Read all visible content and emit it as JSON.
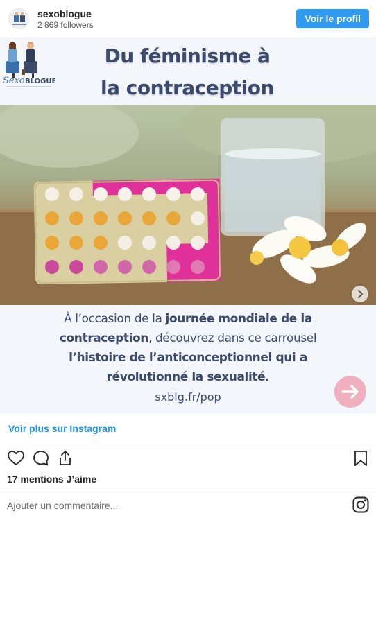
{
  "header": {
    "username": "sexoblogue",
    "followers": "2 869 followers",
    "view_profile_label": "Voir le profil"
  },
  "post": {
    "title_line1": "Du féminisme à",
    "title_line2": "la contraception",
    "brand_logo_text": "SexoBLOGUE",
    "body_line1_prefix": "À l’occasion de la ",
    "body_line1_bold": "journée mondiale de la",
    "body_line2_bold": "contraception",
    "body_line2_rest": ", découvrez dans ce carrousel",
    "body_line3_bold": "l’histoire de l’anticonceptionnel qui a",
    "body_line4_bold": "révolutionné la sexualité.",
    "url": "sxblg.fr/pop"
  },
  "footer": {
    "more_link": "Voir plus sur Instagram",
    "likes": "17 mentions J’aime",
    "comment_placeholder": "Ajouter un commentaire..."
  },
  "icons": {
    "like": "heart-icon",
    "comment": "comment-icon",
    "share": "share-icon",
    "save": "bookmark-icon",
    "instagram": "instagram-icon",
    "next": "chevron-right-icon",
    "slide_arrow": "arrow-right-icon"
  },
  "colors": {
    "accent": "#2f9bf0",
    "link": "#1f94e8",
    "title": "#3c4a6e",
    "pink_arrow": "#f0b0c0"
  }
}
